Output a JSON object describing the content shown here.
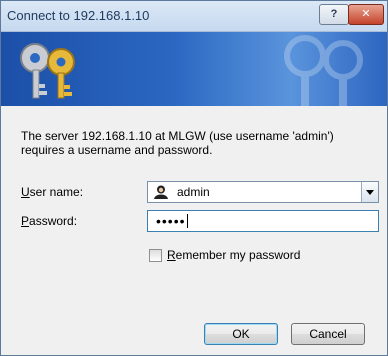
{
  "window": {
    "title": "Connect to 192.168.1.10",
    "help_label": "?",
    "close_label": "✕"
  },
  "prompt": {
    "text_line1": "The server 192.168.1.10 at MLGW (use username 'admin')",
    "text_line2": "requires a username and password."
  },
  "fields": {
    "username_label_accel": "U",
    "username_label_rest": "ser name:",
    "username_value": "admin",
    "password_label_accel": "P",
    "password_label_rest": "assword:",
    "password_mask": "•••••"
  },
  "remember": {
    "label_accel": "R",
    "label_rest": "emember my password",
    "checked": false
  },
  "buttons": {
    "ok_label": "OK",
    "cancel_label": "Cancel"
  },
  "colors": {
    "banner_dark": "#1c4fa8",
    "banner_light": "#5a94dc",
    "focus_border": "#3c7fb1"
  },
  "icons": {
    "banner": "keys-icon",
    "user": "user-icon",
    "dropdown": "chevron-down-icon"
  }
}
